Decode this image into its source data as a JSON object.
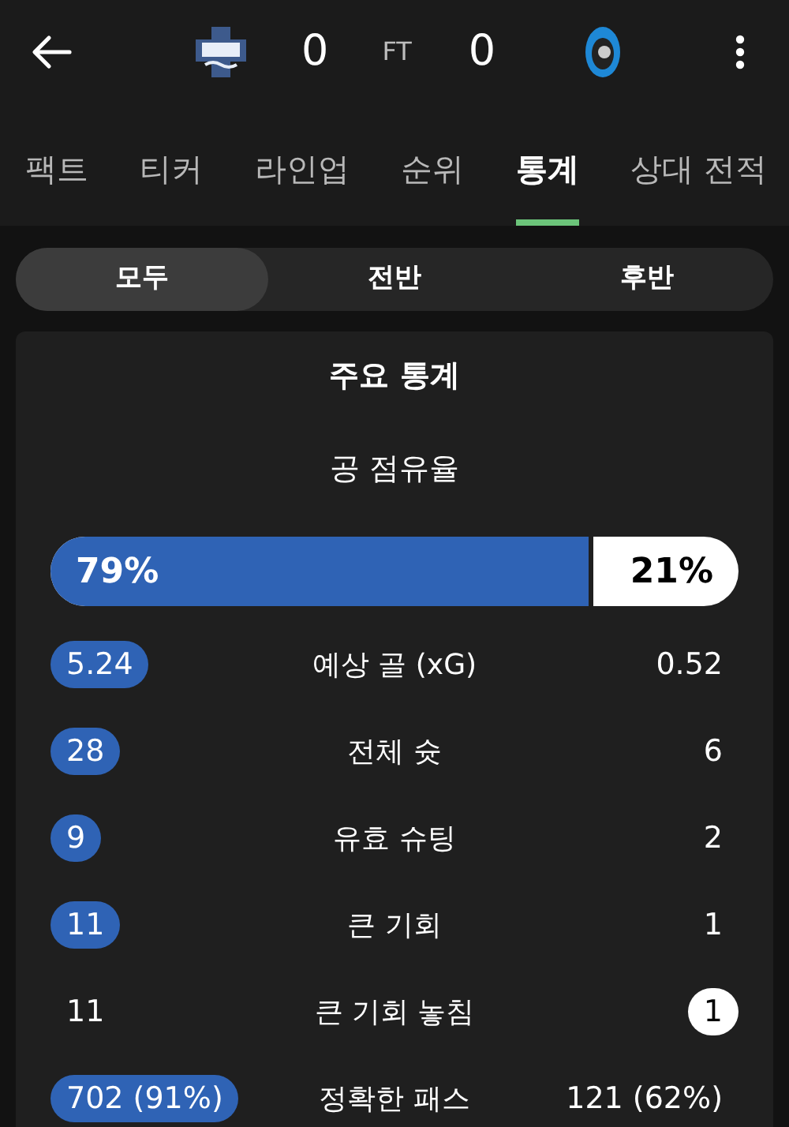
{
  "header": {
    "home_score": "0",
    "status": "FT",
    "away_score": "0"
  },
  "tabs": [
    {
      "label": "팩트",
      "selected": false
    },
    {
      "label": "티커",
      "selected": false
    },
    {
      "label": "라인업",
      "selected": false
    },
    {
      "label": "순위",
      "selected": false
    },
    {
      "label": "통계",
      "selected": true
    },
    {
      "label": "상대 전적",
      "selected": false
    }
  ],
  "periods": [
    {
      "label": "모두",
      "selected": true
    },
    {
      "label": "전반",
      "selected": false
    },
    {
      "label": "후반",
      "selected": false
    }
  ],
  "card": {
    "title": "주요 통계",
    "possession": {
      "label": "공 점유율",
      "home": "79%",
      "away": "21%",
      "level": 0.79
    },
    "stats": [
      {
        "label": "예상 골 (xG)",
        "home": "5.24",
        "away": "0.52",
        "home_highlighted": true,
        "away_highlighted": false
      },
      {
        "label": "전체 슛",
        "home": "28",
        "away": "6",
        "home_highlighted": true,
        "away_highlighted": false
      },
      {
        "label": "유효 슈팅",
        "home": "9",
        "away": "2",
        "home_highlighted": true,
        "away_highlighted": false
      },
      {
        "label": "큰 기회",
        "home": "11",
        "away": "1",
        "home_highlighted": true,
        "away_highlighted": false
      },
      {
        "label": "큰 기회 놓침",
        "home": "11",
        "away": "1",
        "home_highlighted": false,
        "away_highlighted": true
      },
      {
        "label": "정확한 패스",
        "home": "702 (91%)",
        "away": "121 (62%)",
        "home_highlighted": true,
        "away_highlighted": false
      }
    ]
  }
}
